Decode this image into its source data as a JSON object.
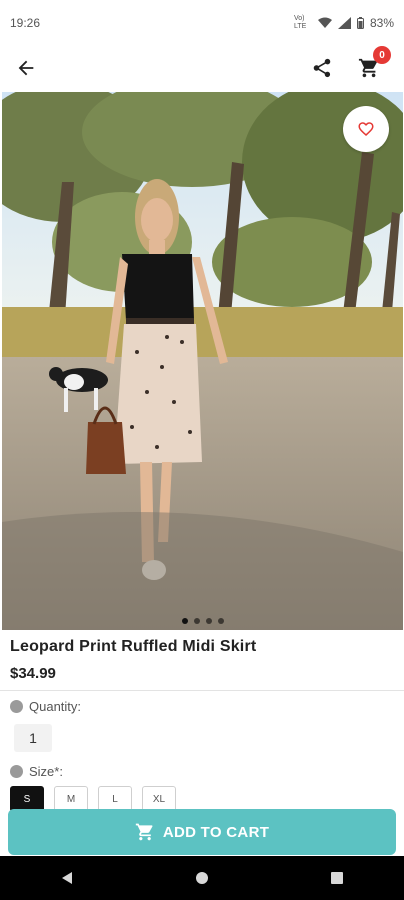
{
  "status_bar": {
    "time": "19:26",
    "network": "Vo) LTE",
    "battery": "83%"
  },
  "toolbar": {
    "cart_count": "0"
  },
  "product": {
    "title": "Leopard Print Ruffled Midi Skirt",
    "price": "$34.99",
    "image_count": 4,
    "active_image": 1
  },
  "options": {
    "quantity_label": "Quantity:",
    "quantity_value": "1",
    "size_label": "Size*:",
    "sizes": [
      "S",
      "M",
      "L",
      "XL"
    ],
    "selected_size": "S"
  },
  "actions": {
    "add_to_cart": "ADD TO CART"
  },
  "colors": {
    "accent": "#5cc2c2",
    "badge": "#e53935",
    "favorite": "#e53935"
  }
}
